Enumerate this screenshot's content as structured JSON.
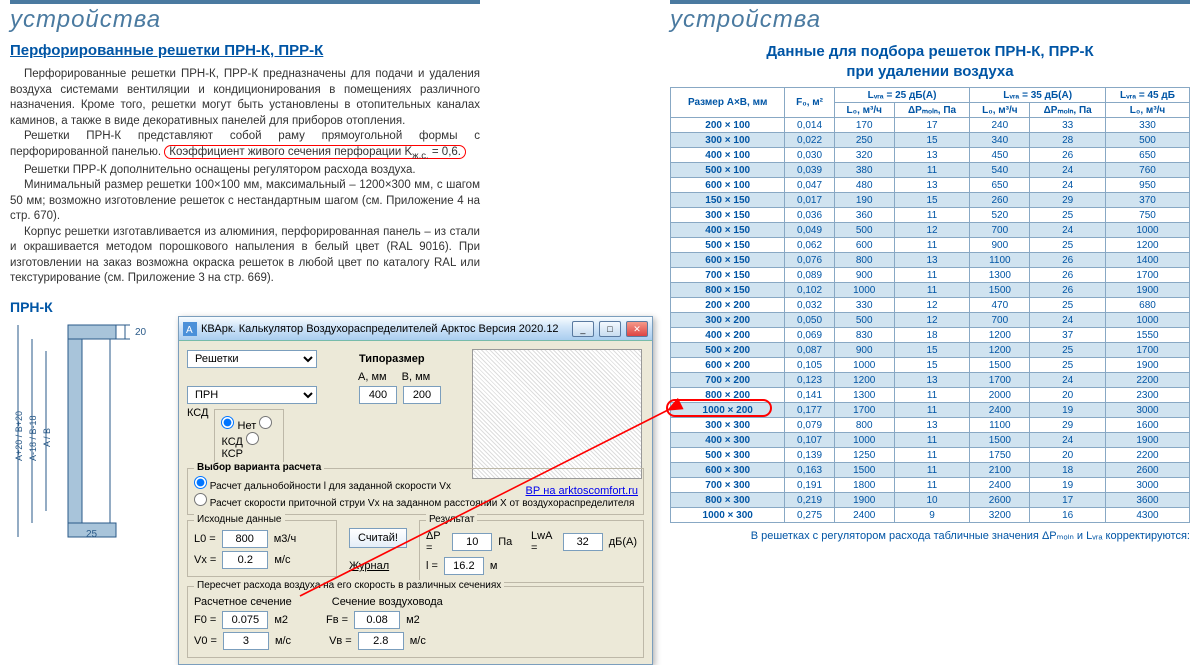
{
  "left": {
    "band": "устройства",
    "title": "Перфорированные решетки ПРН-К, ПРР-К",
    "p1": "Перфорированные решетки ПРН-К, ПРР-К предназначены для подачи и удаления воздуха системами вентиляции и кондиционирования в помещениях различного назначения. Кроме того, решетки могут быть установлены в отопительных каналах каминов, а также в виде декоративных панелей для приборов отопления.",
    "p2a": "Решетки ПРН-К представляют собой раму прямоугольной формы с перфорированной панелью.",
    "p2b": "Коэффициент живого сечения перфорации K",
    "p2b_sub": "ж.с.",
    "p2b_end": " = 0,6.",
    "p3": "Решетки ПРР-К дополнительно оснащены регулятором расхода воздуха.",
    "p4": "Минимальный размер решетки 100×100 мм, максимальный – 1200×300 мм, с шагом 50 мм; возможно изготовление решеток с нестандартным шагом (см. Приложение 4 на стр. 670).",
    "p5": "Корпус решетки изготавливается из алюминия, перфорированная панель – из стали и окрашивается методом порошкового напыления в белый цвет (RAL 9016). При изготовлении на заказ возможна окраска решеток в любой цвет по каталогу RAL или текстурирование (см. Приложение 3 на стр. 669).",
    "diagram_label": "ПРН-К",
    "dims": {
      "top": "20",
      "bottom": "25",
      "vlabels": [
        "A+20 / B+20",
        "A-18 / B-18",
        "A / B"
      ]
    }
  },
  "right": {
    "band": "устройства",
    "title1": "Данные для подбора решеток ПРН-К, ПРР-К",
    "title2": "при удалении воздуха",
    "footnote": "В решетках с регулятором расхода табличные значения ΔPₘₒₗₙ и Lᵥᵣₐ корректируются:",
    "headers": {
      "size": "Размер A×B, мм",
      "f0": "F₀, м²",
      "lwa25": "Lᵥᵣₐ = 25 дБ(А)",
      "lwa35": "Lᵥᵣₐ = 35 дБ(А)",
      "lwa45": "Lᵥᵣₐ = 45 дБ",
      "l0": "L₀, м³/ч",
      "dp": "ΔPₘₒₗₙ, Па"
    },
    "rows": [
      {
        "size": "200 × 100",
        "f0": "0,014",
        "a": "170",
        "b": "17",
        "c": "240",
        "d": "33",
        "e": "330"
      },
      {
        "size": "300 × 100",
        "f0": "0,022",
        "a": "250",
        "b": "15",
        "c": "340",
        "d": "28",
        "e": "500"
      },
      {
        "size": "400 × 100",
        "f0": "0,030",
        "a": "320",
        "b": "13",
        "c": "450",
        "d": "26",
        "e": "650"
      },
      {
        "size": "500 × 100",
        "f0": "0,039",
        "a": "380",
        "b": "11",
        "c": "540",
        "d": "24",
        "e": "760"
      },
      {
        "size": "600 × 100",
        "f0": "0,047",
        "a": "480",
        "b": "13",
        "c": "650",
        "d": "24",
        "e": "950"
      },
      {
        "size": "150 × 150",
        "f0": "0,017",
        "a": "190",
        "b": "15",
        "c": "260",
        "d": "29",
        "e": "370"
      },
      {
        "size": "300 × 150",
        "f0": "0,036",
        "a": "360",
        "b": "11",
        "c": "520",
        "d": "25",
        "e": "750"
      },
      {
        "size": "400 × 150",
        "f0": "0,049",
        "a": "500",
        "b": "12",
        "c": "700",
        "d": "24",
        "e": "1000"
      },
      {
        "size": "500 × 150",
        "f0": "0,062",
        "a": "600",
        "b": "11",
        "c": "900",
        "d": "25",
        "e": "1200"
      },
      {
        "size": "600 × 150",
        "f0": "0,076",
        "a": "800",
        "b": "13",
        "c": "1100",
        "d": "26",
        "e": "1400"
      },
      {
        "size": "700 × 150",
        "f0": "0,089",
        "a": "900",
        "b": "11",
        "c": "1300",
        "d": "26",
        "e": "1700"
      },
      {
        "size": "800 × 150",
        "f0": "0,102",
        "a": "1000",
        "b": "11",
        "c": "1500",
        "d": "26",
        "e": "1900"
      },
      {
        "size": "200 × 200",
        "f0": "0,032",
        "a": "330",
        "b": "12",
        "c": "470",
        "d": "25",
        "e": "680"
      },
      {
        "size": "300 × 200",
        "f0": "0,050",
        "a": "500",
        "b": "12",
        "c": "700",
        "d": "24",
        "e": "1000"
      },
      {
        "size": "400 × 200",
        "f0": "0,069",
        "a": "830",
        "b": "18",
        "c": "1200",
        "d": "37",
        "e": "1550",
        "hl": true
      },
      {
        "size": "500 × 200",
        "f0": "0,087",
        "a": "900",
        "b": "15",
        "c": "1200",
        "d": "25",
        "e": "1700"
      },
      {
        "size": "600 × 200",
        "f0": "0,105",
        "a": "1000",
        "b": "15",
        "c": "1500",
        "d": "25",
        "e": "1900"
      },
      {
        "size": "700 × 200",
        "f0": "0,123",
        "a": "1200",
        "b": "13",
        "c": "1700",
        "d": "24",
        "e": "2200"
      },
      {
        "size": "800 × 200",
        "f0": "0,141",
        "a": "1300",
        "b": "11",
        "c": "2000",
        "d": "20",
        "e": "2300"
      },
      {
        "size": "1000 × 200",
        "f0": "0,177",
        "a": "1700",
        "b": "11",
        "c": "2400",
        "d": "19",
        "e": "3000"
      },
      {
        "size": "300 × 300",
        "f0": "0,079",
        "a": "800",
        "b": "13",
        "c": "1100",
        "d": "29",
        "e": "1600"
      },
      {
        "size": "400 × 300",
        "f0": "0,107",
        "a": "1000",
        "b": "11",
        "c": "1500",
        "d": "24",
        "e": "1900"
      },
      {
        "size": "500 × 300",
        "f0": "0,139",
        "a": "1250",
        "b": "11",
        "c": "1750",
        "d": "20",
        "e": "2200"
      },
      {
        "size": "600 × 300",
        "f0": "0,163",
        "a": "1500",
        "b": "11",
        "c": "2100",
        "d": "18",
        "e": "2600"
      },
      {
        "size": "700 × 300",
        "f0": "0,191",
        "a": "1800",
        "b": "11",
        "c": "2400",
        "d": "19",
        "e": "3000"
      },
      {
        "size": "800 × 300",
        "f0": "0,219",
        "a": "1900",
        "b": "10",
        "c": "2600",
        "d": "17",
        "e": "3600"
      },
      {
        "size": "1000 × 300",
        "f0": "0,275",
        "a": "2400",
        "b": "9",
        "c": "3200",
        "d": "16",
        "e": "4300"
      }
    ]
  },
  "dlg": {
    "title": "КВАрк. Калькулятор Воздухораспределителей Арктос      Версия 2020.12",
    "typeLbl": "Типоразмер",
    "typeA": "А, мм",
    "typeB": "B, мм",
    "selGrille": "Решетки",
    "selPRN": "ПРН",
    "a_val": "400",
    "b_val": "200",
    "ksdLbl": "КСД",
    "ksd_none": "Нет",
    "ksd_ksd": "КСД",
    "ksd_ksr": "КСР",
    "link": "ВР на arktoscomfort.ru",
    "variant_title": "Выбор варианта расчета",
    "variant1": "Расчет дальнобойности l для заданной скорости Vx",
    "variant2": "Расчет скорости приточной струи Vx на заданном расстоянии X от воздухораспределителя",
    "src_title": "Исходные данные",
    "res_title": "Результат",
    "L0_lbl": "L0 =",
    "L0_val": "800",
    "L0_unit": "м3/ч",
    "Vx_lbl": "Vx =",
    "Vx_val": "0.2",
    "Vx_unit": "м/с",
    "dP_lbl": "ΔP =",
    "dP_val": "10",
    "dP_unit": "Па",
    "l_lbl": "l =",
    "l_val": "16.2",
    "l_unit": "м",
    "LwA_lbl": "LwA =",
    "LwA_val": "32",
    "LwA_unit": "дБ(А)",
    "calcBtn": "Считай!",
    "log": "Журнал",
    "recalc_title": "Пересчет расхода воздуха на его скорость в различных сечениях",
    "sec1": "Расчетное сечение",
    "sec2": "Сечение воздуховода",
    "F0_lbl": "F0 =",
    "F0_val": "0.075",
    "F0_unit": "м2",
    "V0_lbl": "V0 =",
    "V0_val": "3",
    "V0_unit": "м/с",
    "Fv_lbl": "Fв =",
    "Fv_val": "0.08",
    "Fv_unit": "м2",
    "Vv_lbl": "Vв =",
    "Vv_val": "2.8",
    "Vv_unit": "м/с"
  }
}
